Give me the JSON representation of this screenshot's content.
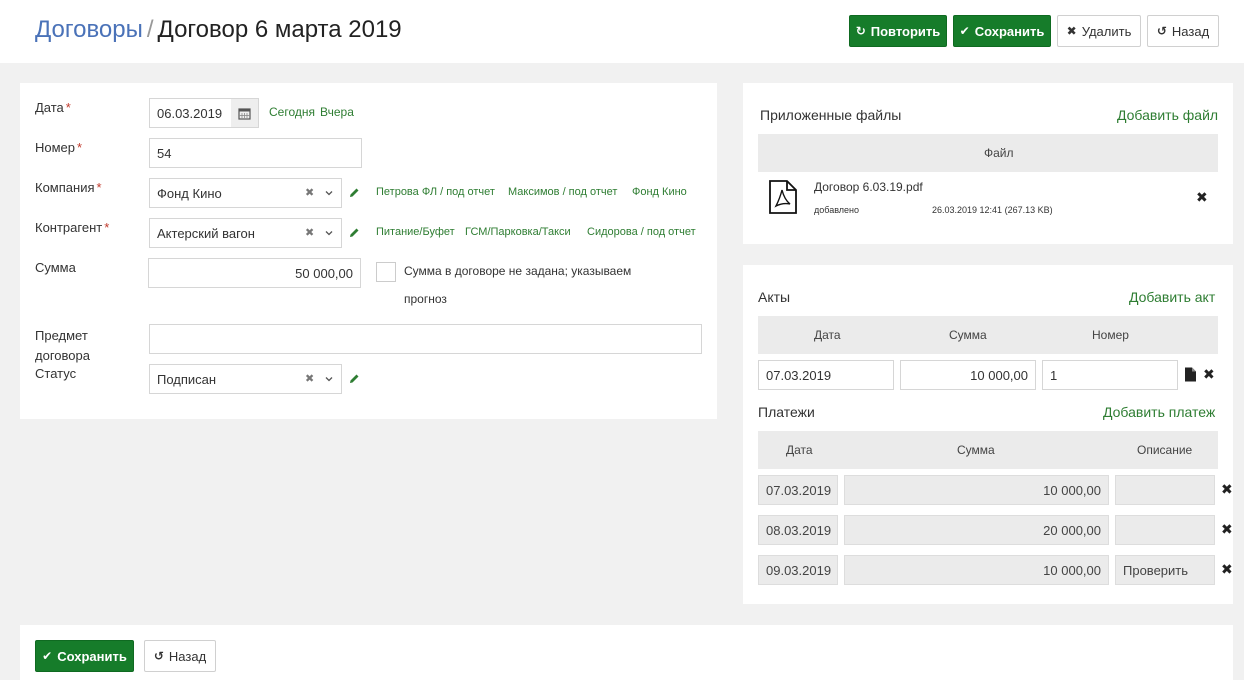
{
  "header": {
    "breadcrumb": "Договоры",
    "separator": "/",
    "title": "Договор 6 марта 2019",
    "buttons": {
      "repeat": "Повторить",
      "save": "Сохранить",
      "delete": "Удалить",
      "back": "Назад"
    }
  },
  "form": {
    "date": {
      "label": "Дата",
      "value": "06.03.2019",
      "today": "Сегодня",
      "yesterday": "Вчера"
    },
    "number": {
      "label": "Номер",
      "value": "54"
    },
    "company": {
      "label": "Компания",
      "value": "Фонд Кино",
      "quick": [
        "Петрова ФЛ / под отчет",
        "Максимов / под отчет",
        "Фонд Кино"
      ]
    },
    "counterparty": {
      "label": "Контрагент",
      "value": "Актерский вагон",
      "quick": [
        "Питание/Буфет",
        "ГСМ/Парковка/Такси",
        "Сидорова / под отчет"
      ]
    },
    "amount": {
      "label": "Сумма",
      "value": "50 000,00",
      "checkbox_label_1": "Сумма в договоре не задана; указываем",
      "checkbox_label_2": "прогноз"
    },
    "subject": {
      "label_1": "Предмет",
      "label_2": "договора",
      "value": ""
    },
    "status": {
      "label": "Статус",
      "value": "Подписан"
    },
    "required_mark": "*"
  },
  "files": {
    "title": "Приложенные файлы",
    "add": "Добавить файл",
    "column": "Файл",
    "items": [
      {
        "name": "Договор 6.03.19.pdf",
        "added_label": "добавлено",
        "meta": "26.03.2019 12:41 (267.13 KB)"
      }
    ]
  },
  "acts": {
    "title": "Акты",
    "add": "Добавить акт",
    "columns": [
      "Дата",
      "Сумма",
      "Номер"
    ],
    "rows": [
      {
        "date": "07.03.2019",
        "amount": "10 000,00",
        "number": "1"
      }
    ]
  },
  "payments": {
    "title": "Платежи",
    "add": "Добавить платеж",
    "columns": [
      "Дата",
      "Сумма",
      "Описание"
    ],
    "rows": [
      {
        "date": "07.03.2019",
        "amount": "10 000,00",
        "desc": ""
      },
      {
        "date": "08.03.2019",
        "amount": "20 000,00",
        "desc": ""
      },
      {
        "date": "09.03.2019",
        "amount": "10 000,00",
        "desc": "Проверить"
      }
    ]
  },
  "footer": {
    "save": "Сохранить",
    "back": "Назад"
  },
  "icons": {
    "check": "check-icon",
    "repeat": "refresh-icon",
    "close": "close-icon",
    "undo": "undo-icon",
    "calendar": "calendar-icon",
    "pencil": "pencil-icon",
    "caret": "chevron-down-icon",
    "pdf": "pdf-file-icon",
    "doc": "document-icon"
  },
  "colors": {
    "accent": "#167c2a",
    "link": "#2e7d32",
    "breadcrumb": "#4a72b8",
    "required": "#c0392b"
  }
}
